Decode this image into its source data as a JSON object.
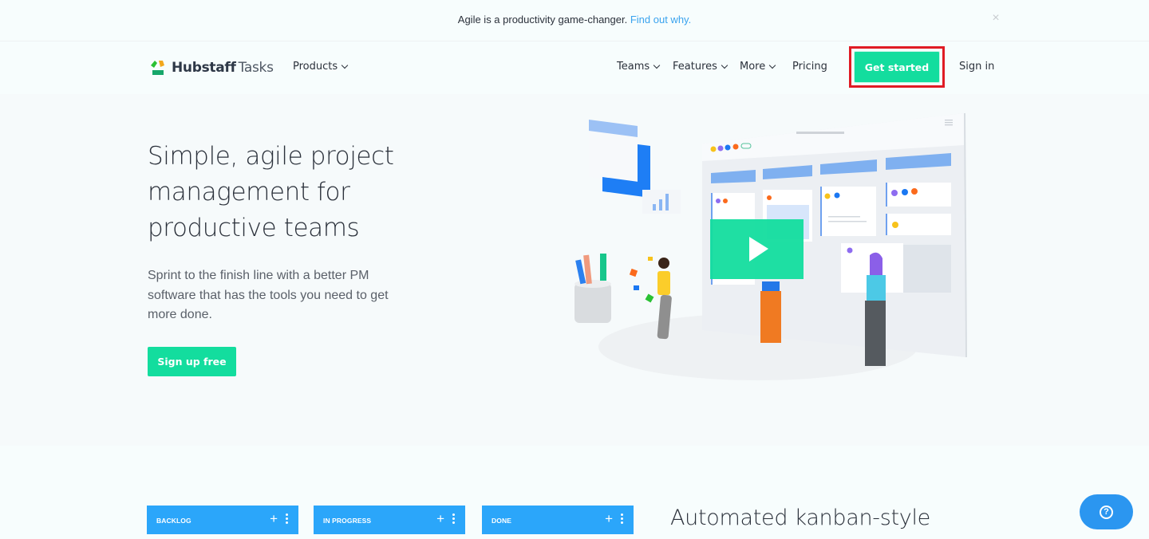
{
  "announcement": {
    "text": "Agile is a productivity game-changer. ",
    "link": "Find out why.",
    "close_icon": "×"
  },
  "nav": {
    "brand_bold": "Hubstaff",
    "brand_light": "Tasks",
    "products": "Products",
    "teams": "Teams",
    "features": "Features",
    "more": "More",
    "pricing": "Pricing",
    "get_started": "Get started",
    "sign_in": "Sign in"
  },
  "hero": {
    "title": "Simple, agile project management for productive teams",
    "subtitle": "Sprint to the finish line with a better PM software that has the tools you need to get more done.",
    "cta": "Sign up free",
    "illustration": "play-video-illustration"
  },
  "kanban": {
    "columns": [
      {
        "label": "BACKLOG",
        "add": "+"
      },
      {
        "label": "IN PROGRESS",
        "add": "+"
      },
      {
        "label": "DONE",
        "add": "+"
      }
    ],
    "section_title": "Automated kanban-style"
  },
  "help": {
    "icon": "?"
  },
  "colors": {
    "brand_green": "#13dd9e",
    "link_blue": "#3aa3ee",
    "kanban_blue": "#2ba6fa",
    "highlight_red": "#e01b24",
    "help_blue": "#2b96f0"
  }
}
